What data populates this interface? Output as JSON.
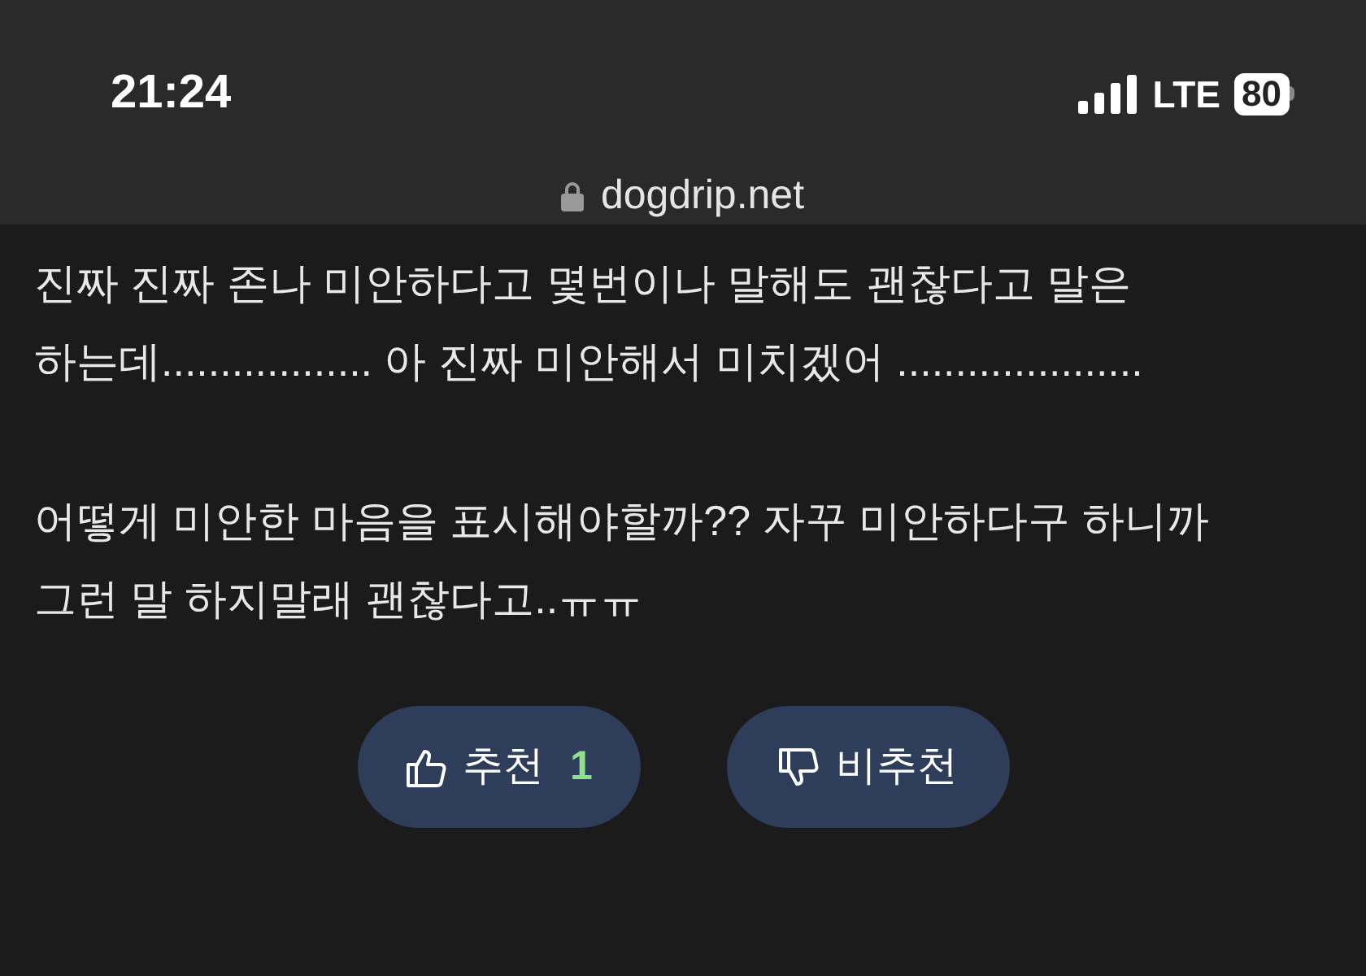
{
  "status_bar": {
    "time": "21:24",
    "network": "LTE",
    "battery": "80"
  },
  "address_bar": {
    "url": "dogdrip.net"
  },
  "post": {
    "paragraphs": [
      "진짜 진짜 존나 미안하다고 몇번이나 말해도 괜찮다고 말은 하는데.................. 아 진짜 미안해서 미치겠어 .....................",
      "어떻게 미안한 마음을 표시해야할까?? 자꾸 미안하다구 하니까 그런 말 하지말래 괜찮다고..ㅠㅠ"
    ]
  },
  "votes": [
    {
      "kind": "up",
      "label": "추천",
      "count": "1"
    },
    {
      "kind": "down",
      "label": "비추천"
    }
  ]
}
